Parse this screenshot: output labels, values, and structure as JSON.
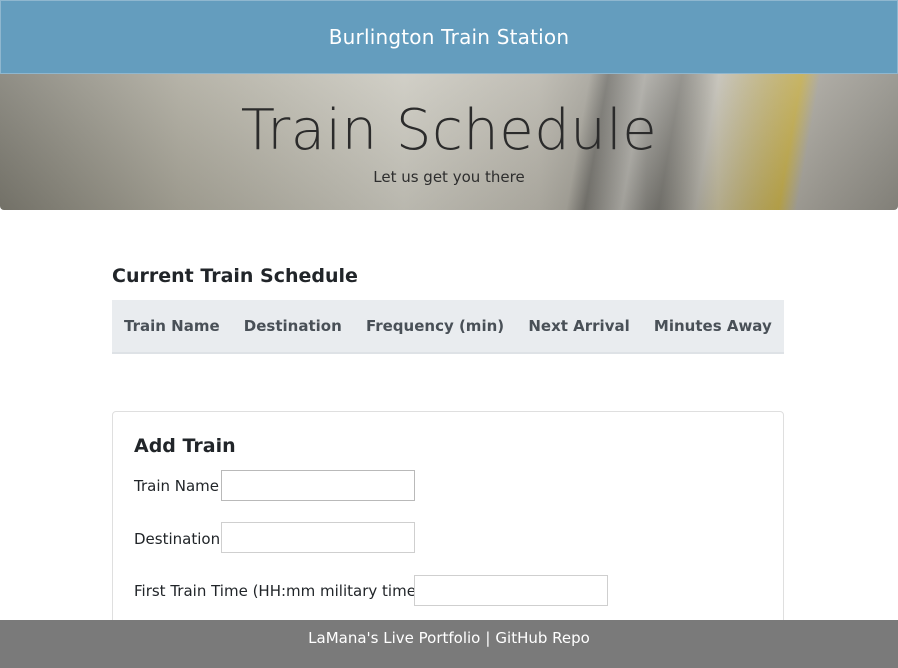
{
  "navbar": {
    "title": "Burlington Train Station",
    "bg_color": "#649dbe"
  },
  "hero": {
    "title": "Train Schedule",
    "subtitle": "Let us get you there"
  },
  "schedule": {
    "title": "Current Train Schedule",
    "columns": [
      "Train Name",
      "Destination",
      "Frequency (min)",
      "Next Arrival",
      "Minutes Away"
    ],
    "rows": []
  },
  "add_train": {
    "title": "Add Train",
    "fields": {
      "train_name": {
        "label": "Train Name",
        "value": ""
      },
      "destination": {
        "label": "Destination",
        "value": ""
      },
      "first_time": {
        "label": "First Train Time (HH:mm military time)",
        "value": ""
      }
    }
  },
  "footer": {
    "portfolio_link": "LaMana's Live Portfolio",
    "separator": "|",
    "github_link": "GitHub Repo",
    "bg_color": "#7a7a7a"
  }
}
